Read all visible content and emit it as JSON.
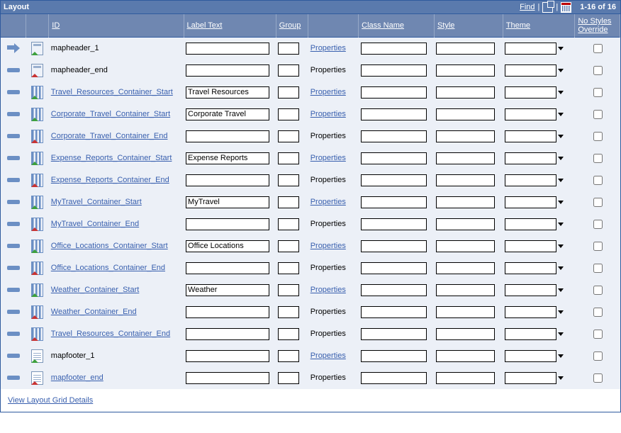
{
  "header": {
    "title": "Layout",
    "find": "Find",
    "count": "1-16 of 16"
  },
  "columns": {
    "id": "ID",
    "label": "Label Text",
    "group": "Group",
    "class_": "Class Name",
    "style": "Style",
    "theme": "Theme",
    "override": "No Styles Override"
  },
  "rows": [
    {
      "current": true,
      "icon": "page-green",
      "id": "mapheader_1",
      "id_link": false,
      "label": "",
      "props_link": true
    },
    {
      "current": false,
      "icon": "page-red",
      "id": "mapheader_end",
      "id_link": false,
      "label": "",
      "props_link": false
    },
    {
      "current": false,
      "icon": "group-green",
      "id": "Travel_Resources_Container_Start",
      "id_link": true,
      "label": "Travel Resources",
      "props_link": true
    },
    {
      "current": false,
      "icon": "group-green",
      "id": "Corporate_Travel_Container_Start",
      "id_link": true,
      "label": "Corporate Travel",
      "props_link": true
    },
    {
      "current": false,
      "icon": "group-red",
      "id": "Corporate_Travel_Container_End",
      "id_link": true,
      "label": "",
      "props_link": false
    },
    {
      "current": false,
      "icon": "group-green",
      "id": "Expense_Reports_Container_Start",
      "id_link": true,
      "label": "Expense Reports",
      "props_link": true
    },
    {
      "current": false,
      "icon": "group-red",
      "id": "Expense_Reports_Container_End",
      "id_link": true,
      "label": "",
      "props_link": false
    },
    {
      "current": false,
      "icon": "group-green",
      "id": "MyTravel_Container_Start",
      "id_link": true,
      "label": "MyTravel",
      "props_link": true
    },
    {
      "current": false,
      "icon": "group-red",
      "id": "MyTravel_Container_End",
      "id_link": true,
      "label": "",
      "props_link": false
    },
    {
      "current": false,
      "icon": "group-green",
      "id": "Office_Locations_Container_Start",
      "id_link": true,
      "label": "Office Locations",
      "props_link": true
    },
    {
      "current": false,
      "icon": "group-red",
      "id": "Office_Locations_Container_End",
      "id_link": true,
      "label": "",
      "props_link": false
    },
    {
      "current": false,
      "icon": "group-green",
      "id": "Weather_Container_Start",
      "id_link": true,
      "label": "Weather",
      "props_link": true
    },
    {
      "current": false,
      "icon": "group-red",
      "id": "Weather_Container_End",
      "id_link": true,
      "label": "",
      "props_link": false
    },
    {
      "current": false,
      "icon": "group-red",
      "id": "Travel_Resources_Container_End",
      "id_link": true,
      "label": "",
      "props_link": false
    },
    {
      "current": false,
      "icon": "doc-green",
      "id": "mapfooter_1",
      "id_link": false,
      "label": "",
      "props_link": true
    },
    {
      "current": false,
      "icon": "doc-red",
      "id": "mapfooter_end",
      "id_link": true,
      "label": "",
      "props_link": false
    }
  ],
  "properties_label": "Properties",
  "footer_link": "View Layout Grid Details"
}
